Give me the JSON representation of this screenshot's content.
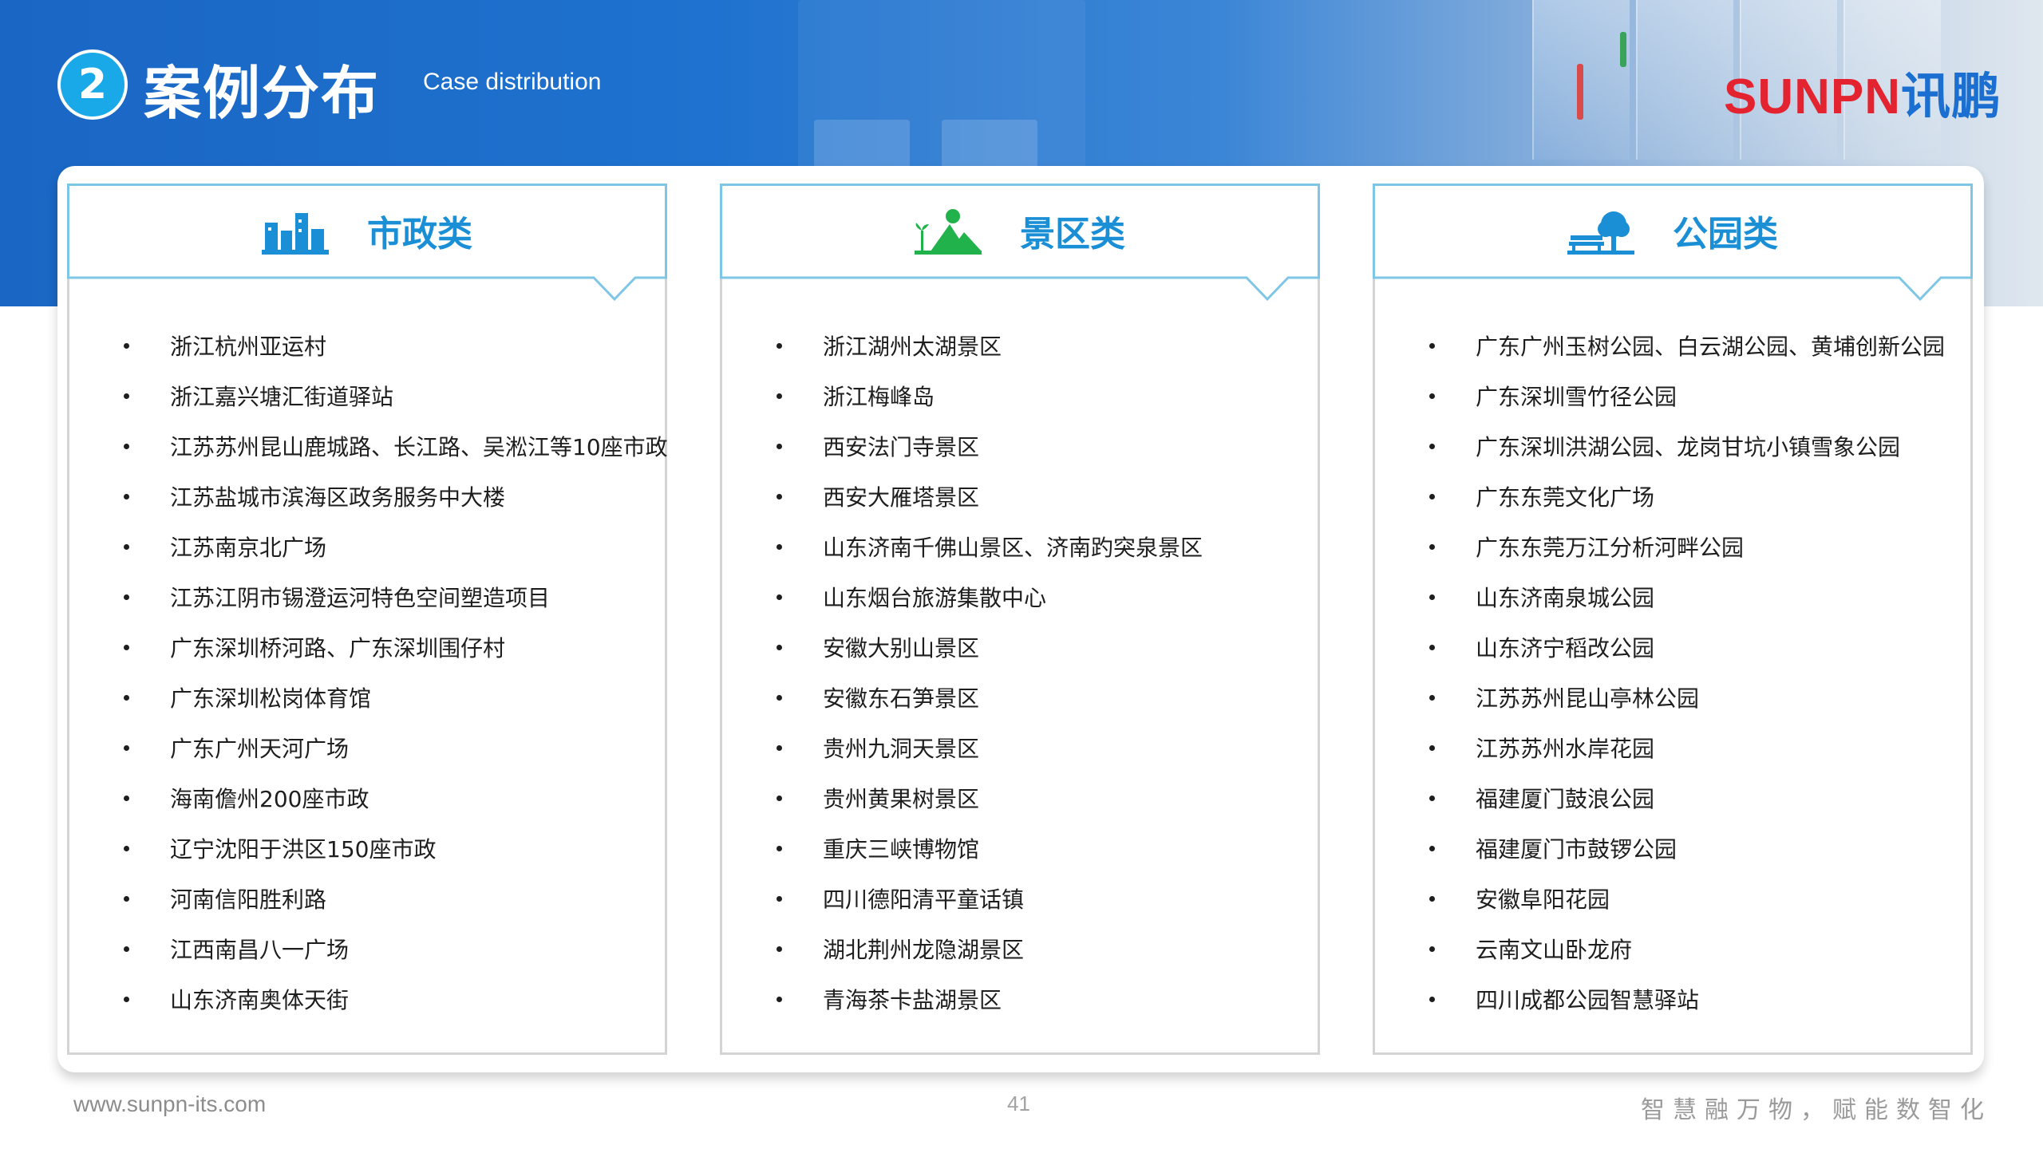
{
  "header": {
    "section_number": "2",
    "title": "案例分布",
    "subtitle": "Case distribution",
    "logo_latin": "SUNPN",
    "logo_cn": "讯鹏"
  },
  "colors": {
    "banner_blue": "#1a66c4",
    "accent_cyan": "#1a8fd6",
    "badge": "#19a8e8",
    "panel_head_border": "#7ec6e6",
    "logo_red": "#e32330"
  },
  "panels": [
    {
      "label": "市政类",
      "icon": "buildings-icon",
      "items": [
        "浙江杭州亚运村",
        "浙江嘉兴塘汇街道驿站",
        "江苏苏州昆山鹿城路、长江路、吴淞江等10座市政",
        "江苏盐城市滨海区政务服务中大楼",
        "江苏南京北广场",
        "江苏江阴市锡澄运河特色空间塑造项目",
        "广东深圳桥河路、广东深圳围仔村",
        "广东深圳松岗体育馆",
        "广东广州天河广场",
        "海南儋州200座市政",
        "辽宁沈阳于洪区150座市政",
        "河南信阳胜利路",
        "江西南昌八一广场",
        "山东济南奥体天街"
      ]
    },
    {
      "label": "景区类",
      "icon": "mountain-icon",
      "items": [
        "浙江湖州太湖景区",
        "浙江梅峰岛",
        "西安法门寺景区",
        "西安大雁塔景区",
        "山东济南千佛山景区、济南趵突泉景区",
        "山东烟台旅游集散中心",
        "安徽大别山景区",
        "安徽东石笋景区",
        "贵州九洞天景区",
        "贵州黄果树景区",
        "重庆三峡博物馆",
        "四川德阳清平童话镇",
        "湖北荆州龙隐湖景区",
        "青海茶卡盐湖景区"
      ]
    },
    {
      "label": "公园类",
      "icon": "park-bench-tree-icon",
      "items": [
        "广东广州玉树公园、白云湖公园、黄埔创新公园",
        "广东深圳雪竹径公园",
        "广东深圳洪湖公园、龙岗甘坑小镇雪象公园",
        "广东东莞文化广场",
        "广东东莞万江分析河畔公园",
        "山东济南泉城公园",
        "山东济宁稻改公园",
        "江苏苏州昆山亭林公园",
        "江苏苏州水岸花园",
        "福建厦门鼓浪公园",
        "福建厦门市鼓锣公园",
        "安徽阜阳花园",
        "云南文山卧龙府",
        "四川成都公园智慧驿站"
      ]
    }
  ],
  "footer": {
    "url": "www.sunpn-its.com",
    "page_number": "41",
    "slogan": "智慧融万物，赋能数智化"
  }
}
